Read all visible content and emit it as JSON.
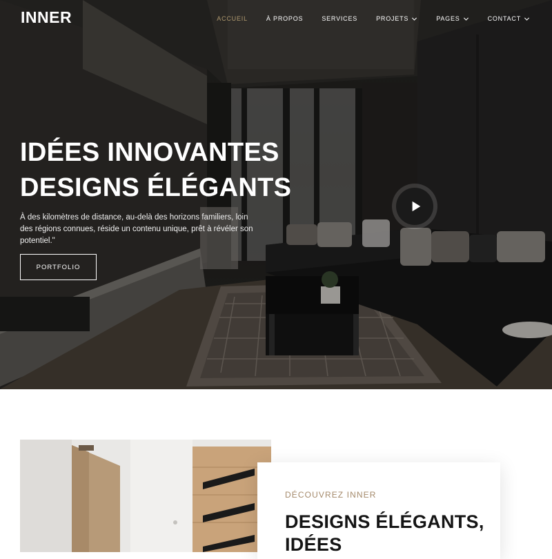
{
  "brand": {
    "logo": "INNER"
  },
  "nav": {
    "items": [
      {
        "label": "ACCUEIL",
        "active": true,
        "has_dropdown": false
      },
      {
        "label": "À PROPOS",
        "active": false,
        "has_dropdown": false
      },
      {
        "label": "SERVICES",
        "active": false,
        "has_dropdown": false
      },
      {
        "label": "PROJETS",
        "active": false,
        "has_dropdown": true
      },
      {
        "label": "PAGES",
        "active": false,
        "has_dropdown": true
      },
      {
        "label": "CONTACT",
        "active": false,
        "has_dropdown": true
      }
    ]
  },
  "hero": {
    "headline_line1": "IDÉES INNOVANTES",
    "headline_line2": "DESIGNS ÉLÉGANTS",
    "lead": "À des kilomètres de distance, au-delà des horizons familiers, loin des régions connues, réside un contenu unique, prêt à révéler son potentiel.\"",
    "button_label": "PORTFOLIO",
    "play_icon": "play-icon"
  },
  "about": {
    "eyebrow": "DÉCOUVREZ INNER",
    "title": "DESIGNS ÉLÉGANTS, IDÉES"
  },
  "colors": {
    "accent": "#b09a6f",
    "eyebrow": "#a4896a",
    "hero_dark": "#1f1e1c",
    "text_dark": "#151515"
  }
}
